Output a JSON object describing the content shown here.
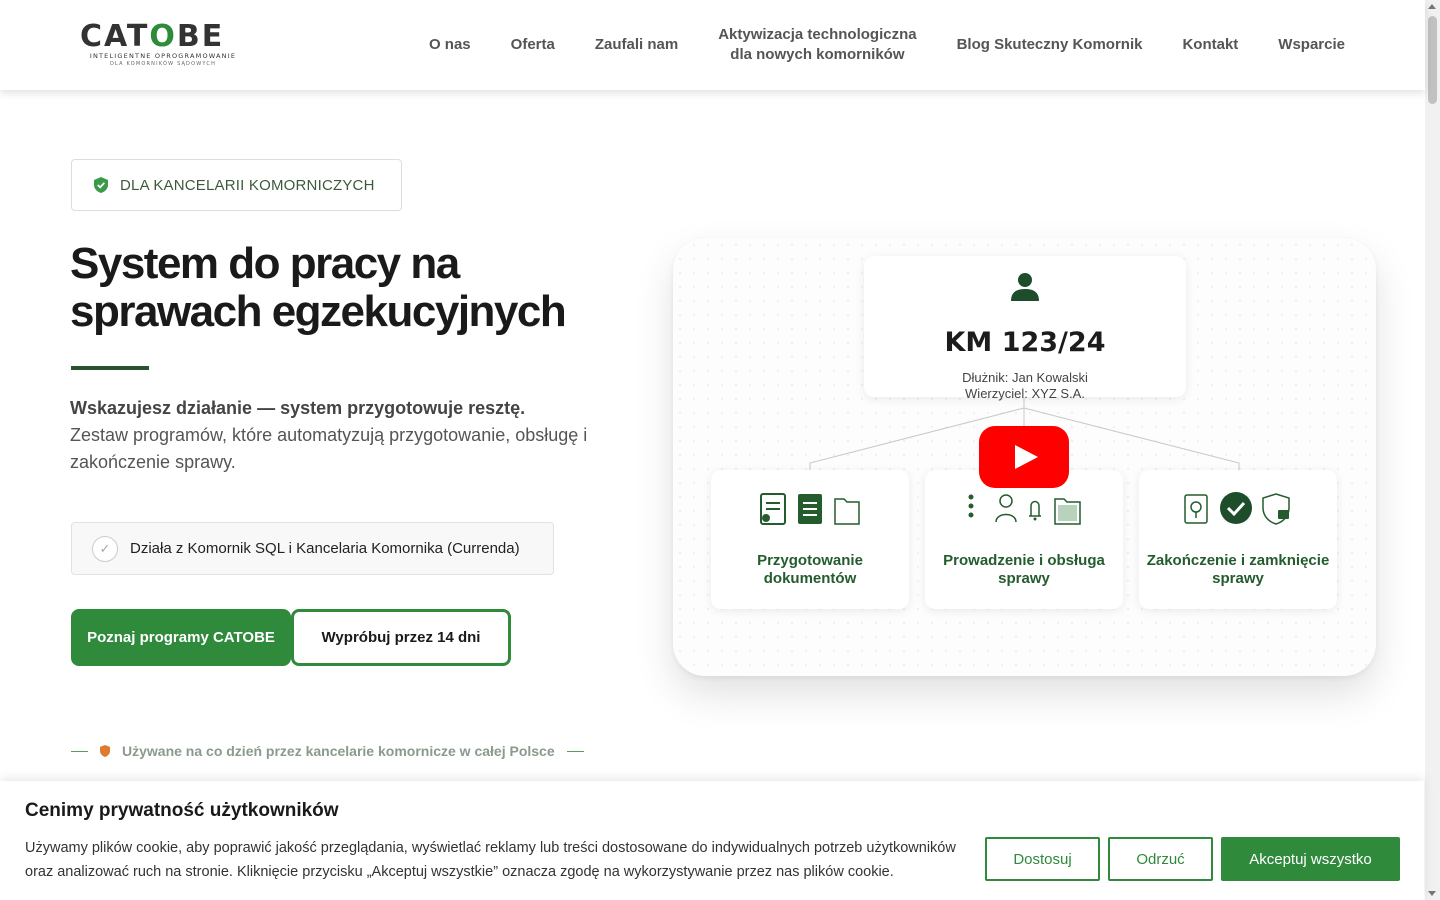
{
  "header": {
    "logo": {
      "wordmark": "CATOBE",
      "tagline": "INTELIGENTNE OPROGRAMOWANIE",
      "tagline2": "DLA KOMORNIKÓW SĄDOWYCH"
    },
    "nav": [
      {
        "label": "O nas"
      },
      {
        "label": "Oferta"
      },
      {
        "label": "Zaufali nam"
      },
      {
        "label_line1": "Aktywizacja technologiczna",
        "label_line2": "dla nowych komorników"
      },
      {
        "label": "Blog Skuteczny Komornik"
      },
      {
        "label": "Kontakt"
      },
      {
        "label": "Wsparcie"
      }
    ]
  },
  "hero": {
    "badge": "DLA KANCELARII KOMORNICZYCH",
    "title_line1": "System do pracy na",
    "title_line2": "sprawach egzekucyjnych",
    "lead_bold": "Wskazujesz działanie — system przygotowuje resztę.",
    "lead_text": "Zestaw programów, które automatyzują przygotowanie, obsługę i zakończenie sprawy.",
    "feature": "Działa z Komornik SQL i Kancelaria Komornika (Currenda)",
    "btn_primary": "Poznaj programy CATOBE",
    "btn_secondary": "Wypróbuj przez 14 dni",
    "used_by": "Używane na co dzień przez kancelarie komornicze w całej Polsce"
  },
  "video": {
    "case_number": "KM 123/24",
    "debtor": "Dłużnik: Jan Kowalski",
    "creditor": "Wierzyciel: XYZ S.A.",
    "steps": [
      {
        "line1": "Przygotowanie",
        "line2": "dokumentów"
      },
      {
        "line1": "Prowadzenie i obsługa",
        "line2": "sprawy"
      },
      {
        "line1": "Zakończenie i zamknięcie",
        "line2": "sprawy"
      }
    ]
  },
  "cookie": {
    "title": "Cenimy prywatność użytkowników",
    "text": "Używamy plików cookie, aby poprawić jakość przeglądania, wyświetlać reklamy lub treści dostosowane do indywidualnych potrzeb użytkowników oraz analizować ruch na stronie. Kliknięcie przycisku „Akceptuj wszystkie” oznacza zgodę na wykorzystywanie przez nas plików cookie.",
    "customize": "Dostosuj",
    "reject": "Odrzuć",
    "accept": "Akceptuj wszystko"
  },
  "colors": {
    "brand_green": "#2f8a3c",
    "dark_green": "#245c2e",
    "youtube_red": "#ff0000"
  }
}
